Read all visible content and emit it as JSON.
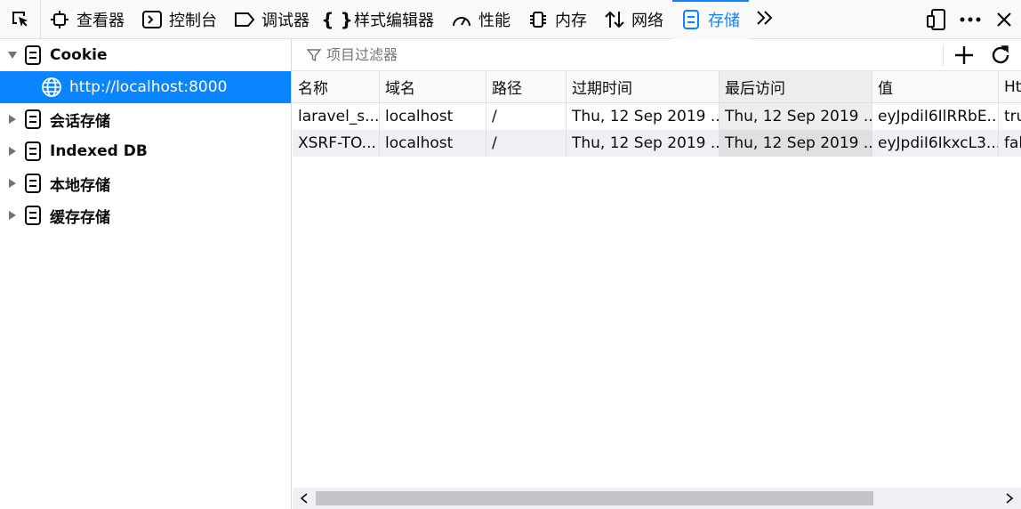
{
  "toolbar": {
    "tabs": [
      {
        "label": "查看器",
        "icon": "inspector-icon"
      },
      {
        "label": "控制台",
        "icon": "console-icon"
      },
      {
        "label": "调试器",
        "icon": "debugger-icon"
      },
      {
        "label": "样式编辑器",
        "icon": "style-editor-icon"
      },
      {
        "label": "性能",
        "icon": "performance-icon"
      },
      {
        "label": "内存",
        "icon": "memory-icon"
      },
      {
        "label": "网络",
        "icon": "network-icon"
      },
      {
        "label": "存储",
        "icon": "storage-icon"
      }
    ],
    "active_tab": "存储"
  },
  "sidebar": {
    "items": [
      {
        "label": "Cookie",
        "expanded": true
      },
      {
        "label": "http://localhost:8000",
        "selected": true
      },
      {
        "label": "会话存储"
      },
      {
        "label": "Indexed DB"
      },
      {
        "label": "本地存储"
      },
      {
        "label": "缓存存储"
      }
    ]
  },
  "filter": {
    "placeholder": "项目过滤器"
  },
  "table": {
    "columns": [
      "名称",
      "域名",
      "路径",
      "过期时间",
      "最后访问",
      "值",
      "Ht"
    ],
    "rows": [
      [
        "laravel_s...",
        "localhost",
        "/",
        "Thu, 12 Sep 2019 ...",
        "Thu, 12 Sep 2019 ...",
        "eyJpdiI6IlRRbE...",
        "tru"
      ],
      [
        "XSRF-TO...",
        "localhost",
        "/",
        "Thu, 12 Sep 2019 ...",
        "Thu, 12 Sep 2019 ...",
        "eyJpdiI6IkxcL3...",
        "fal"
      ]
    ]
  },
  "colors": {
    "accent": "#0a84ff",
    "toolbar_bg": "#f9f9fa"
  }
}
